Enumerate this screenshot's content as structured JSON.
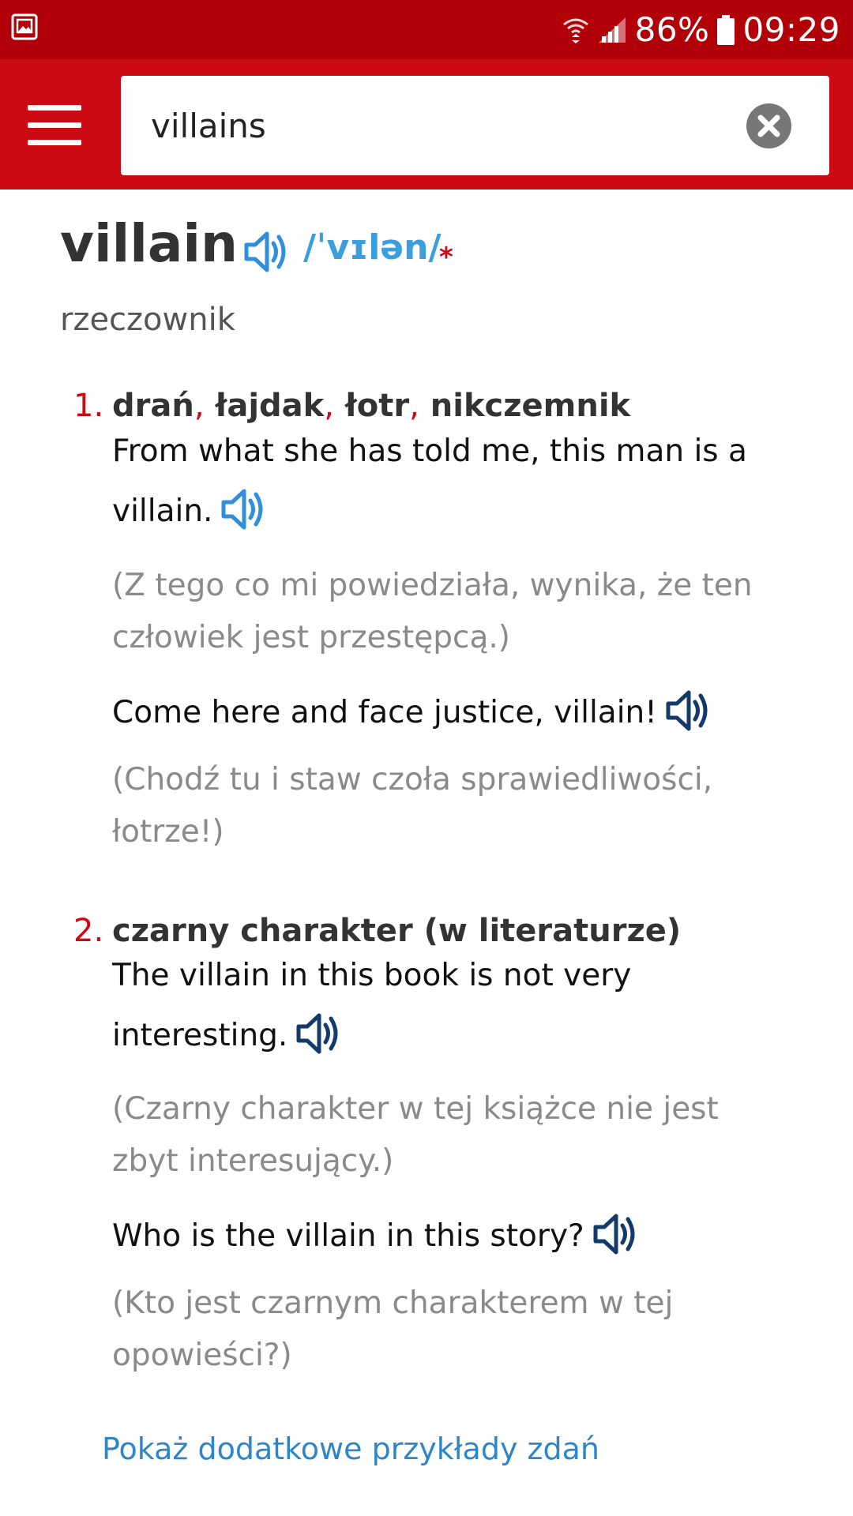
{
  "status_bar": {
    "battery": "86%",
    "time": "09:29",
    "icons": [
      "gallery-notification-icon",
      "wifi-icon",
      "signal-icon",
      "battery-icon"
    ]
  },
  "header": {
    "menu_icon": "hamburger-menu-icon",
    "search": {
      "value": "villains",
      "clear_icon": "clear-x-icon"
    }
  },
  "entry": {
    "headword": "villain",
    "ipa": "/ˈvɪlən/",
    "asterisk": "*",
    "part_of_speech": "rzeczownik",
    "senses": [
      {
        "number": "1.",
        "translations": [
          "drań",
          "łajdak",
          "łotr",
          "nikczemnik"
        ],
        "separator": ",",
        "examples": [
          {
            "text": "From what she has told me, this man is a villain.",
            "translation": "(Z tego co mi powiedziała, wynika, że ten człowiek jest przestępcą.)",
            "speaker_color": "#2f8fd8"
          },
          {
            "text": "Come here and face justice, villain!",
            "translation": "(Chodź tu i staw czoła sprawiedliwości, łotrze!)",
            "speaker_color": "#123a6b"
          }
        ]
      },
      {
        "number": "2.",
        "title": "czarny charakter (w literaturze)",
        "examples": [
          {
            "text": "The villain in this book is not very interesting.",
            "translation": "(Czarny charakter w tej książce nie jest zbyt interesujący.)",
            "speaker_color": "#123a6b"
          },
          {
            "text": "Who is the villain in this story?",
            "translation": "(Kto jest czarnym charakterem w tej opowieści?)",
            "speaker_color": "#123a6b"
          }
        ]
      }
    ],
    "more_examples_link": "Pokaż dodatkowe przykłady zdań"
  },
  "colors": {
    "status_bar": "#b10008",
    "header": "#cc0a14",
    "accent_red": "#cc0a14",
    "ipa_blue": "#3c9fdd",
    "link_blue": "#2e86c9",
    "speaker_light": "#2f8fd8",
    "speaker_dark": "#123a6b",
    "translation_gray": "#8a8a8a"
  }
}
